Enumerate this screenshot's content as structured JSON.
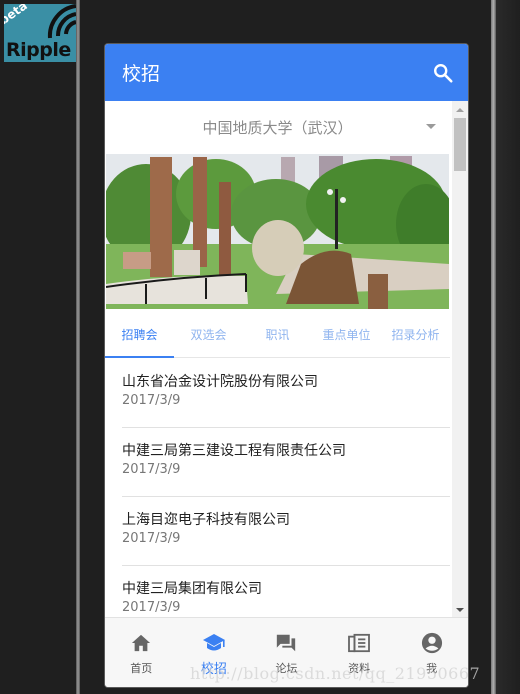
{
  "emulator": {
    "logo_badge": "beta",
    "logo_text": "Ripple"
  },
  "appbar": {
    "title": "校招",
    "search_icon": "search-icon"
  },
  "school_selector": {
    "selected": "中国地质大学（武汉）"
  },
  "banner": {
    "description": "campus stone garden photo"
  },
  "tabs": [
    {
      "label": "招聘会",
      "active": true
    },
    {
      "label": "双选会",
      "active": false
    },
    {
      "label": "职讯",
      "active": false
    },
    {
      "label": "重点单位",
      "active": false
    },
    {
      "label": "招录分析",
      "active": false
    }
  ],
  "list": [
    {
      "company": "山东省冶金设计院股份有限公司",
      "date": "2017/3/9"
    },
    {
      "company": "中建三局第三建设工程有限责任公司",
      "date": "2017/3/9"
    },
    {
      "company": "上海目迩电子科技有限公司",
      "date": "2017/3/9"
    },
    {
      "company": "中建三局集团有限公司",
      "date": "2017/3/9"
    }
  ],
  "bottom_nav": [
    {
      "label": "首页",
      "icon": "home-icon",
      "active": false
    },
    {
      "label": "校招",
      "icon": "graduation-cap-icon",
      "active": true
    },
    {
      "label": "论坛",
      "icon": "forum-icon",
      "active": false
    },
    {
      "label": "资料",
      "icon": "document-icon",
      "active": false
    },
    {
      "label": "我",
      "icon": "account-icon",
      "active": false
    }
  ],
  "colors": {
    "primary": "#3b80f2",
    "tab_inactive": "#8fb4ef",
    "nav_inactive": "#666666"
  },
  "watermark": "http://blog.csdn.net/qq_21950667"
}
